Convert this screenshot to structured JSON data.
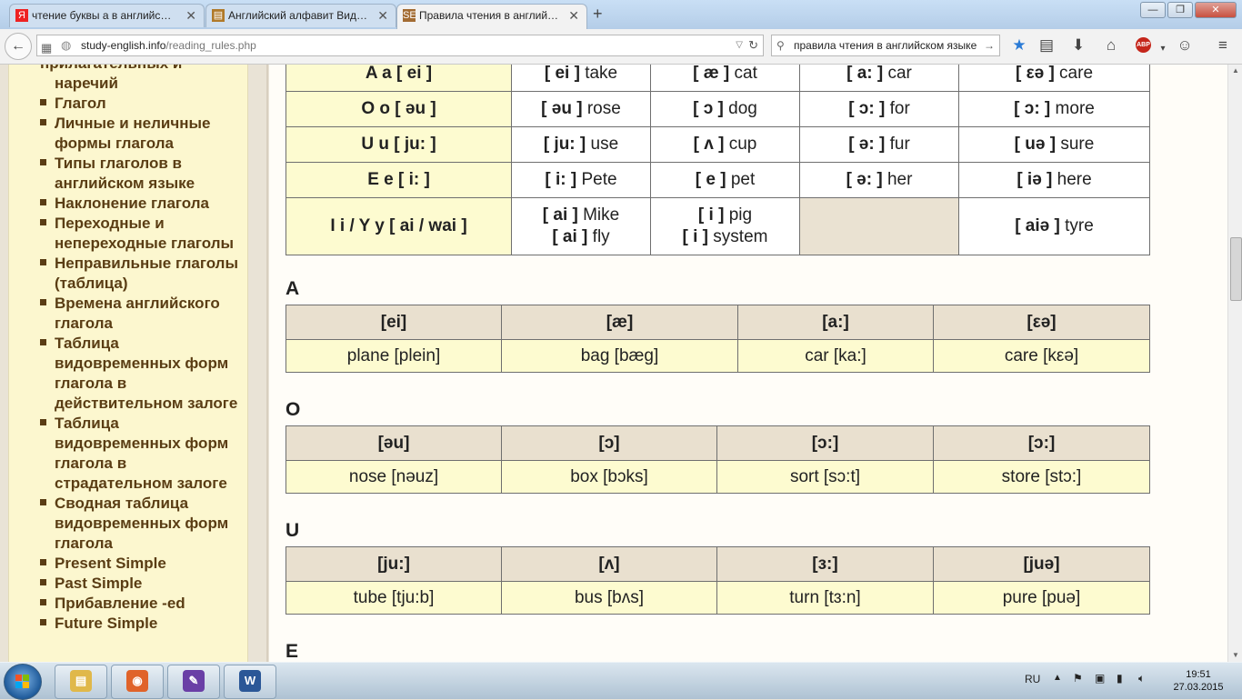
{
  "browser": {
    "tabs": [
      {
        "label": "чтение буквы а в английс…",
        "favicon": "Я",
        "favicon_color": "#e22"
      },
      {
        "label": "Английский алфавит Вид…",
        "favicon": "▤",
        "favicon_color": "#b07a2a"
      },
      {
        "label": "Правила чтения в англий…",
        "favicon": "SE",
        "favicon_color": "#a26b32"
      }
    ],
    "url_host": "study-english.info",
    "url_path": "/reading_rules.php",
    "search_query": "правила чтения в английском языке"
  },
  "sidebar": {
    "items": [
      {
        "bullet": false,
        "label": "прилагательных и наречий"
      },
      {
        "bullet": true,
        "label": "Глагол"
      },
      {
        "bullet": true,
        "label": "Личные и неличные формы глагола"
      },
      {
        "bullet": true,
        "label": "Типы глаголов в английском языке"
      },
      {
        "bullet": true,
        "label": "Наклонение глагола"
      },
      {
        "bullet": true,
        "label": "Переходные и непереходные глаголы"
      },
      {
        "bullet": true,
        "label": "Неправильные глаголы (таблица)"
      },
      {
        "bullet": true,
        "label": "Времена английского глагола"
      },
      {
        "bullet": true,
        "label": "Таблица видовременных форм глагола в действительном залоге"
      },
      {
        "bullet": true,
        "label": "Таблица видовременных форм глагола в страдательном залоге"
      },
      {
        "bullet": true,
        "label": "Сводная таблица видовременных форм глагола"
      },
      {
        "bullet": true,
        "label": "Present Simple"
      },
      {
        "bullet": true,
        "label": "Past Simple"
      },
      {
        "bullet": true,
        "label": "Прибавление -ed"
      },
      {
        "bullet": true,
        "label": "Future Simple"
      }
    ]
  },
  "main_table": {
    "rows": [
      {
        "letter": "A a [ ei ]",
        "cells": [
          {
            "lines": [
              {
                "ipa": "[ ei ]",
                "word": "take"
              }
            ]
          },
          {
            "lines": [
              {
                "ipa": "[ æ ]",
                "word": "cat"
              }
            ]
          },
          {
            "lines": [
              {
                "ipa": "[ a: ]",
                "word": "car"
              }
            ]
          },
          {
            "lines": [
              {
                "ipa": "[ εə ]",
                "word": "care"
              }
            ]
          }
        ]
      },
      {
        "letter": "O o [ əu ]",
        "cells": [
          {
            "lines": [
              {
                "ipa": "[ əu ]",
                "word": "rose"
              }
            ]
          },
          {
            "lines": [
              {
                "ipa": "[ ɔ ]",
                "word": "dog"
              }
            ]
          },
          {
            "lines": [
              {
                "ipa": "[ ɔ: ]",
                "word": "for"
              }
            ]
          },
          {
            "lines": [
              {
                "ipa": "[ ɔ: ]",
                "word": "more"
              }
            ]
          }
        ]
      },
      {
        "letter": "U u [ ju: ]",
        "cells": [
          {
            "lines": [
              {
                "ipa": "[ ju: ]",
                "word": "use"
              }
            ]
          },
          {
            "lines": [
              {
                "ipa": "[ ʌ ]",
                "word": "cup"
              }
            ]
          },
          {
            "lines": [
              {
                "ipa": "[ ə: ]",
                "word": "fur"
              }
            ]
          },
          {
            "lines": [
              {
                "ipa": "[ uə ]",
                "word": "sure"
              }
            ]
          }
        ]
      },
      {
        "letter": "E e [ i: ]",
        "cells": [
          {
            "lines": [
              {
                "ipa": "[ i: ]",
                "word": "Pete"
              }
            ]
          },
          {
            "lines": [
              {
                "ipa": "[ e ]",
                "word": "pet"
              }
            ]
          },
          {
            "lines": [
              {
                "ipa": "[ ə: ]",
                "word": "her"
              }
            ]
          },
          {
            "lines": [
              {
                "ipa": "[ iə ]",
                "word": "here"
              }
            ]
          }
        ]
      },
      {
        "letter": "I i / Y y [ ai / wai ]",
        "cells": [
          {
            "lines": [
              {
                "ipa": "[ ai ]",
                "word": "Mike"
              },
              {
                "ipa": "[ ai ]",
                "word": "fly"
              }
            ]
          },
          {
            "lines": [
              {
                "ipa": "[ i ]",
                "word": "pig"
              },
              {
                "ipa": "[ i ]",
                "word": "system"
              }
            ]
          },
          {
            "lines": []
          },
          {
            "lines": [
              {
                "ipa": "[ aiə ]",
                "word": "tyre"
              }
            ]
          }
        ]
      }
    ]
  },
  "sections": [
    {
      "title": "A",
      "headers": [
        "[ei]",
        "[æ]",
        "[a:]",
        "[εə]"
      ],
      "examples": [
        "plane [plein]",
        "bag [bæg]",
        "car [ka:]",
        "care [kεə]"
      ]
    },
    {
      "title": "O",
      "headers": [
        "[əu]",
        "[ɔ]",
        "[ɔ:]",
        "[ɔ:]"
      ],
      "examples": [
        "nose [nəuz]",
        "box [bɔks]",
        "sort [sɔ:t]",
        "store [stɔ:]"
      ]
    },
    {
      "title": "U",
      "headers": [
        "[ju:]",
        "[ʌ]",
        "[ɜ:]",
        "[juə]"
      ],
      "examples": [
        "tube [tju:b]",
        "bus [bʌs]",
        "turn [tɜ:n]",
        "pure [puə]"
      ]
    },
    {
      "title": "E",
      "headers": [],
      "examples": []
    }
  ],
  "taskbar": {
    "apps": [
      {
        "name": "explorer",
        "color": "#e0b84a",
        "glyph": "▤"
      },
      {
        "name": "firefox",
        "color": "#e0632a",
        "glyph": "◉"
      },
      {
        "name": "editor",
        "color": "#6a3fa6",
        "glyph": "✎"
      },
      {
        "name": "word",
        "color": "#2b5797",
        "glyph": "W"
      }
    ],
    "language": "RU",
    "time": "19:51",
    "date": "27.03.2015"
  }
}
